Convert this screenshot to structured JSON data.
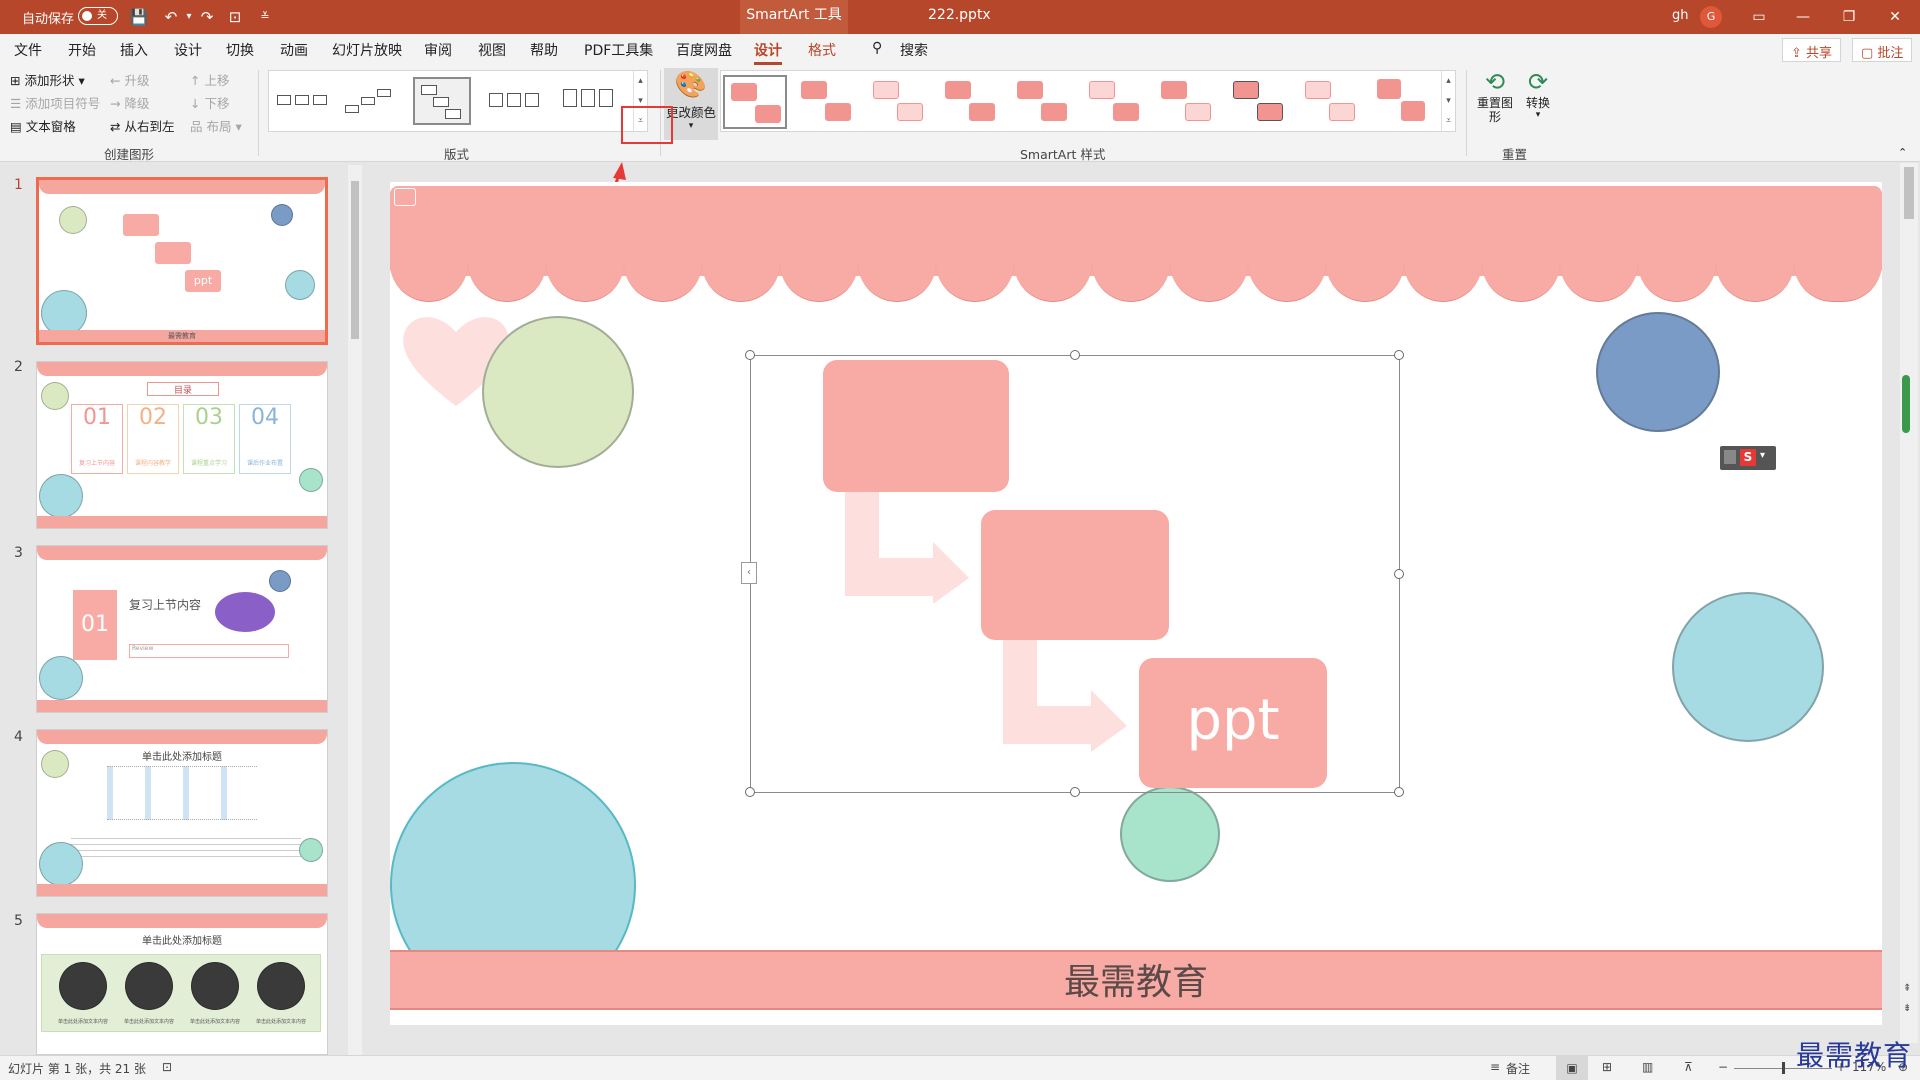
{
  "titlebar": {
    "autosave_label": "自动保存",
    "autosave_state": "关",
    "context_tab": "SmartArt 工具",
    "filename": "222.pptx",
    "user": "gh",
    "avatar_initial": "G",
    "icons": [
      "save-icon",
      "undo-icon",
      "redo-icon",
      "present-icon",
      "customize-icon"
    ],
    "window_icons": [
      "ribbon-display-icon",
      "minimize-icon",
      "restore-icon",
      "close-icon"
    ]
  },
  "tabs": {
    "items": [
      "文件",
      "开始",
      "插入",
      "设计",
      "切换",
      "动画",
      "幻灯片放映",
      "审阅",
      "视图",
      "帮助",
      "PDF工具集",
      "百度网盘",
      "设计",
      "格式"
    ],
    "active_index": 12,
    "search_label": "搜索",
    "share_label": "共享",
    "comments_label": "批注"
  },
  "ribbon": {
    "create": {
      "add_shape": "添加形状",
      "add_bullet": "添加项目符号",
      "text_pane": "文本窗格",
      "promote": "升级",
      "demote": "降级",
      "right_to_left": "从右到左",
      "move_up": "上移",
      "move_down": "下移",
      "layout": "布局",
      "group_label": "创建图形"
    },
    "layouts": {
      "group_label": "版式"
    },
    "styles": {
      "change_colors": "更改颜色",
      "group_label": "SmartArt 样式"
    },
    "reset": {
      "reset_graphic": "重置图形",
      "convert": "转换",
      "group_label": "重置"
    }
  },
  "slides": {
    "numbers": [
      "1",
      "2",
      "3",
      "4",
      "5"
    ],
    "thumb1": {
      "box_text": "ppt",
      "footer": "最需教育"
    },
    "thumb2": {
      "title": "目录",
      "nums": [
        "01",
        "02",
        "03",
        "04"
      ],
      "captions": [
        "复习上节内容",
        "课程内容教学",
        "课程重点学习",
        "课后作业布置"
      ]
    },
    "thumb3": {
      "num": "01",
      "title": "复习上节内容",
      "sub": "Review"
    },
    "thumb4": {
      "title": "单击此处添加标题"
    },
    "thumb5": {
      "title": "单击此处添加标题",
      "caption": "单击此处添加文本内容"
    }
  },
  "slide": {
    "smartart_last_text": "ppt",
    "banner_text": "最需教育"
  },
  "colors": {
    "accent": "#b7472a",
    "salmon": "#f8aba4",
    "green": "#dbe9c3",
    "blue": "#7a9bc6",
    "teal": "#a6dbe3",
    "mint": "#a8e3cb"
  },
  "status": {
    "slide_info": "幻灯片 第 1 张，共 21 张",
    "notes": "备注",
    "zoom": "117%"
  },
  "watermark": "最需教育"
}
